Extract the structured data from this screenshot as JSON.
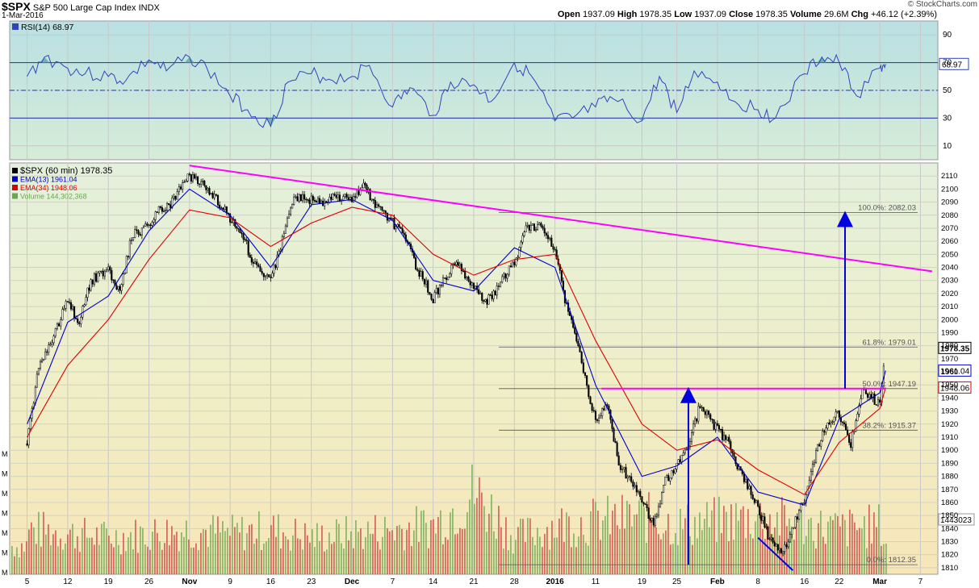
{
  "header": {
    "symbol": "$SPX",
    "name": "S&P 500 Large Cap Index",
    "exchange": "INDX",
    "date": "1-Mar-2016",
    "open_label": "Open",
    "open": "1937.09",
    "high_label": "High",
    "high": "1978.35",
    "low_label": "Low",
    "low": "1937.09",
    "close_label": "Close",
    "close": "1978.35",
    "volume_label": "Volume",
    "volume": "29.6M",
    "chg_label": "Chg",
    "chg": "+46.12 (+2.39%)",
    "credit": "© StockCharts.com"
  },
  "colors": {
    "rsi_line": "#3344bb",
    "rsi_fill": "#5aa8a8",
    "candle": "#000000",
    "ema13": "#0000cc",
    "ema34": "#dd0000",
    "trendline": "#ff00ff",
    "arrow": "#0000dd",
    "fib_line": "#555555",
    "vol_up": "#6aa84f",
    "vol_down": "#cc4444"
  },
  "chart_data": [
    {
      "type": "line",
      "name": "RSI panel",
      "legend": "RSI(14) 68.97",
      "current_value": "68.97",
      "ylim": [
        0,
        100
      ],
      "y_ticks": [
        "90",
        "70",
        "50",
        "30",
        "10"
      ],
      "reference_lines": [
        70,
        50,
        30
      ],
      "series": [
        {
          "name": "RSI(14)",
          "x": [
            "2015-10-05",
            "2015-10-08",
            "2015-10-12",
            "2015-10-15",
            "2015-10-19",
            "2015-10-22",
            "2015-10-26",
            "2015-10-29",
            "2015-11-02",
            "2015-11-05",
            "2015-11-09",
            "2015-11-12",
            "2015-11-16",
            "2015-11-19",
            "2015-11-23",
            "2015-11-26",
            "2015-11-30",
            "2015-12-03",
            "2015-12-07",
            "2015-12-10",
            "2015-12-14",
            "2015-12-17",
            "2015-12-21",
            "2015-12-24",
            "2015-12-28",
            "2015-12-31",
            "2016-01-04",
            "2016-01-07",
            "2016-01-11",
            "2016-01-14",
            "2016-01-19",
            "2016-01-22",
            "2016-01-25",
            "2016-01-28",
            "2016-02-01",
            "2016-02-04",
            "2016-02-08",
            "2016-02-11",
            "2016-02-16",
            "2016-02-19",
            "2016-02-22",
            "2016-02-25",
            "2016-02-29",
            "2016-03-01"
          ],
          "values": [
            60,
            74,
            66,
            62,
            60,
            57,
            72,
            64,
            74,
            66,
            46,
            36,
            24,
            56,
            62,
            58,
            60,
            68,
            38,
            52,
            32,
            56,
            54,
            42,
            70,
            60,
            28,
            30,
            38,
            44,
            28,
            60,
            34,
            64,
            56,
            42,
            36,
            30,
            62,
            74,
            70,
            46,
            66,
            69
          ]
        }
      ]
    },
    {
      "type": "line",
      "name": "Price panel",
      "legend": [
        "$SPX (60 min) 1978.35",
        "EMA(13) 1961.04",
        "EMA(34) 1948.06",
        "Volume 144,302,368"
      ],
      "ylim": [
        1805,
        2120
      ],
      "y_ticks": [
        "2110",
        "2100",
        "2090",
        "2080",
        "2070",
        "2060",
        "2050",
        "2040",
        "2030",
        "2020",
        "2010",
        "2000",
        "1990",
        "1980",
        "1970",
        "1960",
        "1950",
        "1940",
        "1930",
        "1920",
        "1910",
        "1900",
        "1890",
        "1880",
        "1870",
        "1860",
        "1850",
        "1840",
        "1830",
        "1820",
        "1810"
      ],
      "x_ticks": [
        "5",
        "12",
        "19",
        "26",
        "Nov",
        "9",
        "16",
        "23",
        "Dec",
        "7",
        "14",
        "21",
        "28",
        "2016",
        "11",
        "19",
        "25",
        "Feb",
        "8",
        "16",
        "22",
        "Mar",
        "7"
      ],
      "x_tick_dates": [
        "2015-10-05",
        "2015-10-12",
        "2015-10-19",
        "2015-10-26",
        "2015-11-02",
        "2015-11-09",
        "2015-11-16",
        "2015-11-23",
        "2015-11-30",
        "2015-12-07",
        "2015-12-14",
        "2015-12-21",
        "2015-12-28",
        "2016-01-04",
        "2016-01-11",
        "2016-01-19",
        "2016-01-25",
        "2016-02-01",
        "2016-02-08",
        "2016-02-16",
        "2016-02-22",
        "2016-02-29",
        "2016-03-07"
      ],
      "badges": {
        "close": "1978.35",
        "ema13": "1961.04",
        "ema34": "1948.06",
        "volume": "1443023"
      },
      "series": [
        {
          "name": "$SPX",
          "x": [
            "2015-10-05",
            "2015-10-07",
            "2015-10-09",
            "2015-10-12",
            "2015-10-14",
            "2015-10-16",
            "2015-10-19",
            "2015-10-21",
            "2015-10-23",
            "2015-10-26",
            "2015-10-28",
            "2015-10-30",
            "2015-11-02",
            "2015-11-04",
            "2015-11-06",
            "2015-11-09",
            "2015-11-11",
            "2015-11-13",
            "2015-11-16",
            "2015-11-18",
            "2015-11-20",
            "2015-11-23",
            "2015-11-25",
            "2015-11-27",
            "2015-11-30",
            "2015-12-02",
            "2015-12-04",
            "2015-12-07",
            "2015-12-09",
            "2015-12-11",
            "2015-12-14",
            "2015-12-16",
            "2015-12-18",
            "2015-12-21",
            "2015-12-23",
            "2015-12-25",
            "2015-12-28",
            "2015-12-30",
            "2016-01-01",
            "2016-01-04",
            "2016-01-06",
            "2016-01-08",
            "2016-01-11",
            "2016-01-13",
            "2016-01-15",
            "2016-01-19",
            "2016-01-21",
            "2016-01-23",
            "2016-01-25",
            "2016-01-27",
            "2016-01-29",
            "2016-02-01",
            "2016-02-03",
            "2016-02-05",
            "2016-02-08",
            "2016-02-10",
            "2016-02-12",
            "2016-02-16",
            "2016-02-18",
            "2016-02-20",
            "2016-02-22",
            "2016-02-24",
            "2016-02-26",
            "2016-02-29",
            "2016-03-01"
          ],
          "values": [
            1905,
            1965,
            1982,
            2014,
            1998,
            2030,
            2038,
            2020,
            2064,
            2072,
            2085,
            2090,
            2110,
            2104,
            2096,
            2078,
            2068,
            2042,
            2030,
            2060,
            2094,
            2092,
            2090,
            2094,
            2092,
            2104,
            2088,
            2074,
            2066,
            2042,
            2016,
            2032,
            2046,
            2024,
            2012,
            2024,
            2044,
            2070,
            2072,
            2055,
            2010,
            1978,
            1922,
            1935,
            1890,
            1862,
            1842,
            1876,
            1890,
            1905,
            1934,
            1916,
            1905,
            1882,
            1856,
            1832,
            1820,
            1862,
            1898,
            1922,
            1928,
            1905,
            1948,
            1934,
            1978
          ]
        },
        {
          "name": "EMA(13)",
          "x": [
            "2015-10-05",
            "2015-10-12",
            "2015-10-19",
            "2015-10-26",
            "2015-11-02",
            "2015-11-09",
            "2015-11-16",
            "2015-11-23",
            "2015-11-30",
            "2015-12-07",
            "2015-12-14",
            "2015-12-21",
            "2015-12-28",
            "2016-01-04",
            "2016-01-11",
            "2016-01-19",
            "2016-01-25",
            "2016-02-01",
            "2016-02-08",
            "2016-02-16",
            "2016-02-22",
            "2016-02-29",
            "2016-03-01"
          ],
          "values": [
            1920,
            1998,
            2018,
            2068,
            2100,
            2080,
            2040,
            2088,
            2092,
            2076,
            2030,
            2022,
            2055,
            2040,
            1950,
            1880,
            1888,
            1910,
            1868,
            1858,
            1924,
            1944,
            1961
          ]
        },
        {
          "name": "EMA(34)",
          "x": [
            "2015-10-05",
            "2015-10-12",
            "2015-10-19",
            "2015-10-26",
            "2015-11-02",
            "2015-11-09",
            "2015-11-16",
            "2015-11-23",
            "2015-11-30",
            "2015-12-07",
            "2015-12-14",
            "2015-12-21",
            "2015-12-28",
            "2016-01-04",
            "2016-01-11",
            "2016-01-19",
            "2016-01-25",
            "2016-02-01",
            "2016-02-08",
            "2016-02-16",
            "2016-02-22",
            "2016-02-29",
            "2016-03-01"
          ],
          "values": [
            1910,
            1965,
            2000,
            2046,
            2084,
            2078,
            2056,
            2074,
            2086,
            2080,
            2050,
            2034,
            2046,
            2050,
            1984,
            1920,
            1900,
            1908,
            1885,
            1866,
            1906,
            1932,
            1948
          ]
        }
      ],
      "fibonacci": [
        {
          "label": "100.0%: 2082.03",
          "value": 2082.03
        },
        {
          "label": "61.8%: 1979.01",
          "value": 1979.01
        },
        {
          "label": "50.0%: 1947.19",
          "value": 1947.19
        },
        {
          "label": "38.2%: 1915.37",
          "value": 1915.37
        },
        {
          "label": "0.0%: 1812.35",
          "value": 1812.35
        }
      ],
      "trendlines": [
        {
          "from": {
            "x": "2015-11-02",
            "y": 2118
          },
          "to": {
            "x": "2016-03-09",
            "y": 2037
          }
        },
        {
          "from": {
            "x": "2016-01-12",
            "y": 1947.19
          },
          "to": {
            "x": "2016-03-01",
            "y": 1947.19
          }
        },
        {
          "from": {
            "x": "2016-02-08",
            "y": 1833
          },
          "to": {
            "x": "2016-02-14",
            "y": 1808
          }
        }
      ],
      "arrows": [
        {
          "x": "2016-01-27",
          "from": 1812.35,
          "to": 1947.19
        },
        {
          "x": "2016-02-23",
          "from": 1947.19,
          "to": 2082.03
        }
      ],
      "volume": {
        "scale_labels": [
          "M",
          "M",
          "M",
          "M",
          "M",
          "M",
          "M"
        ],
        "x": [
          "2015-10-05",
          "2015-10-12",
          "2015-10-19",
          "2015-10-26",
          "2015-11-02",
          "2015-11-09",
          "2015-11-16",
          "2015-11-23",
          "2015-11-30",
          "2015-12-07",
          "2015-12-14",
          "2015-12-21",
          "2015-12-28",
          "2016-01-04",
          "2016-01-11",
          "2016-01-19",
          "2016-01-25",
          "2016-02-01",
          "2016-02-08",
          "2016-02-16",
          "2016-02-22",
          "2016-02-29",
          "2016-03-01"
        ],
        "levels": [
          0.55,
          0.5,
          0.45,
          0.5,
          0.55,
          0.5,
          0.55,
          0.45,
          0.5,
          0.55,
          0.6,
          1.0,
          0.45,
          0.6,
          0.65,
          0.7,
          0.6,
          0.65,
          0.7,
          0.6,
          0.55,
          0.6,
          0.35
        ]
      }
    }
  ]
}
